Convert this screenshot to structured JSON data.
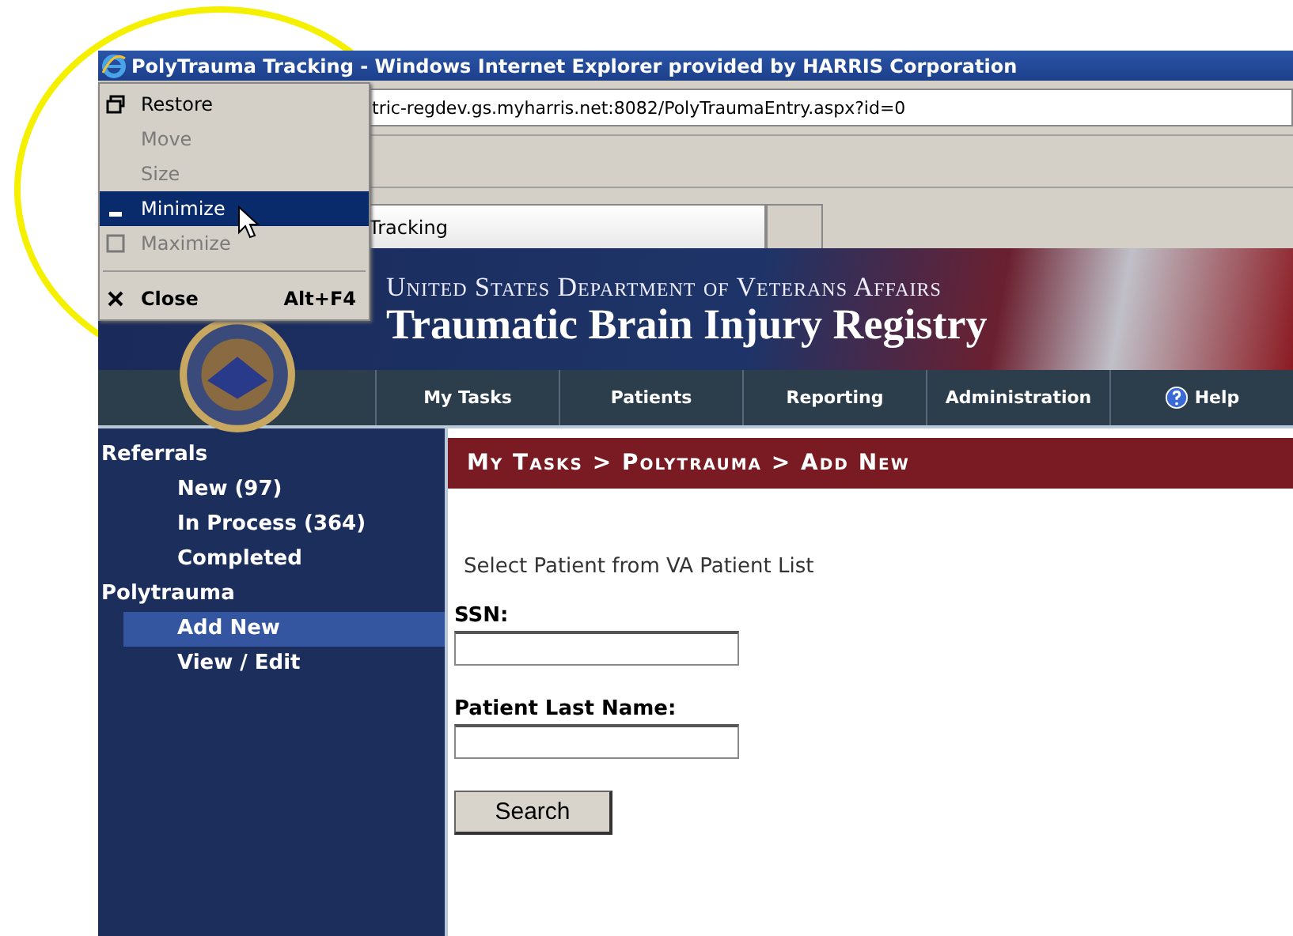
{
  "window": {
    "title": "PolyTrauma Tracking - Windows Internet Explorer provided by HARRIS Corporation"
  },
  "address_bar": {
    "value": "tric-regdev.gs.myharris.net:8082/PolyTraumaEntry.aspx?id=0"
  },
  "tab": {
    "label": "Tracking"
  },
  "system_menu": {
    "items": [
      {
        "kind": "item",
        "label": "Restore",
        "disabled": false,
        "selected": false,
        "bold": false
      },
      {
        "kind": "item",
        "label": "Move",
        "disabled": true,
        "selected": false,
        "bold": false
      },
      {
        "kind": "item",
        "label": "Size",
        "disabled": true,
        "selected": false,
        "bold": false
      },
      {
        "kind": "item",
        "label": "Minimize",
        "disabled": false,
        "selected": true,
        "bold": false
      },
      {
        "kind": "item",
        "label": "Maximize",
        "disabled": true,
        "selected": false,
        "bold": false
      },
      {
        "kind": "separator"
      },
      {
        "kind": "item",
        "label": "Close",
        "shortcut": "Alt+F4",
        "disabled": false,
        "selected": false,
        "bold": true
      }
    ]
  },
  "banner": {
    "agency": "United States Department of Veterans Affairs",
    "title": "Traumatic Brain Injury Registry"
  },
  "nav": {
    "items": [
      {
        "label": "My Tasks"
      },
      {
        "label": "Patients"
      },
      {
        "label": "Reporting"
      },
      {
        "label": "Administration"
      },
      {
        "label": "Help"
      }
    ]
  },
  "sidebar": {
    "groups": [
      {
        "label": "Referrals",
        "children": [
          {
            "label": "New (97)",
            "selected": false
          },
          {
            "label": "In Process (364)",
            "selected": false
          },
          {
            "label": "Completed",
            "selected": false
          }
        ]
      },
      {
        "label": "Polytrauma",
        "children": [
          {
            "label": "Add New",
            "selected": true
          },
          {
            "label": "View / Edit",
            "selected": false
          }
        ]
      }
    ]
  },
  "breadcrumb": "My Tasks > Polytrauma > Add New",
  "form": {
    "legend": "Select Patient from VA Patient List",
    "fields": [
      {
        "label": "SSN:"
      },
      {
        "label": "Patient Last Name:"
      }
    ],
    "button": "Search"
  }
}
